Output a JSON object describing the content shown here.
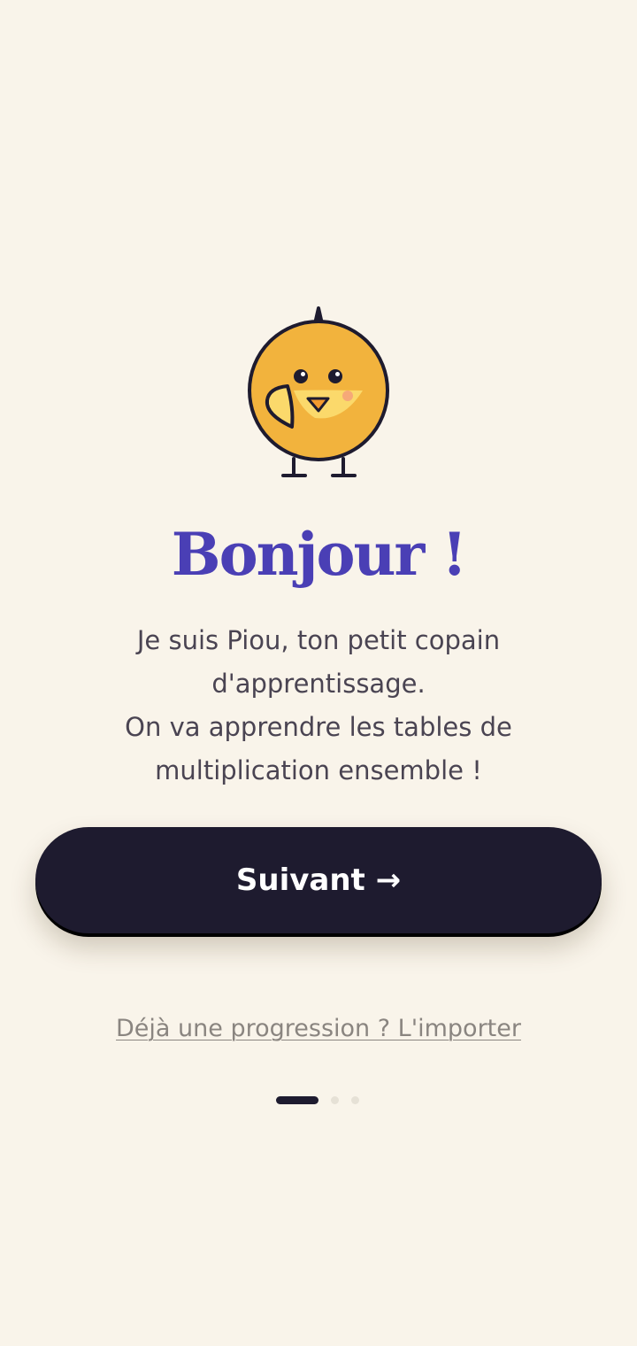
{
  "onboarding": {
    "mascot_icon": "chick-mascot-icon",
    "title": "Bonjour !",
    "intro_lines": [
      "Je suis Piou, ton petit copain",
      "d'apprentissage.",
      "On va apprendre les tables de",
      "multiplication ensemble !"
    ],
    "next_label": "Suivant →",
    "import_link": "Déjà une progression ? L'importer",
    "steps": {
      "current": 1,
      "total": 3
    }
  },
  "colors": {
    "background": "#f9f4ea",
    "title": "#4a3fb5",
    "button": "#1e1b2f",
    "mascot_body": "#f2b33d"
  }
}
